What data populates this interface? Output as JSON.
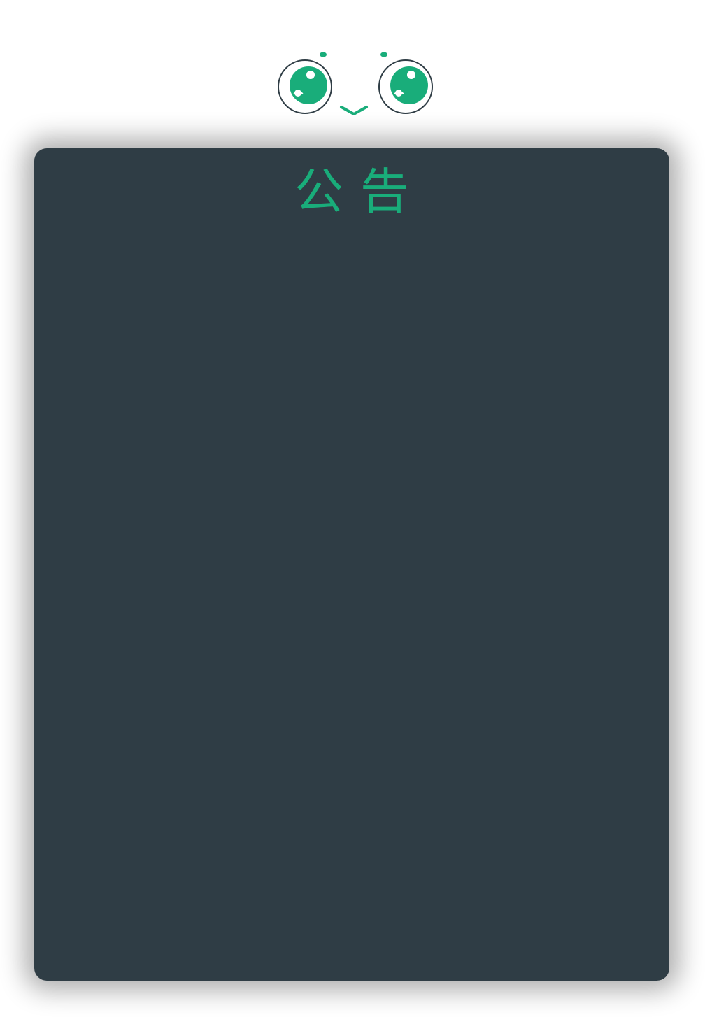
{
  "notice": {
    "title": "公告"
  },
  "colors": {
    "accent": "#19ad7a",
    "panel": "#2f3d45",
    "outline": "#2f3d45"
  },
  "icons": {
    "mascot": "smiling-face-icon"
  }
}
